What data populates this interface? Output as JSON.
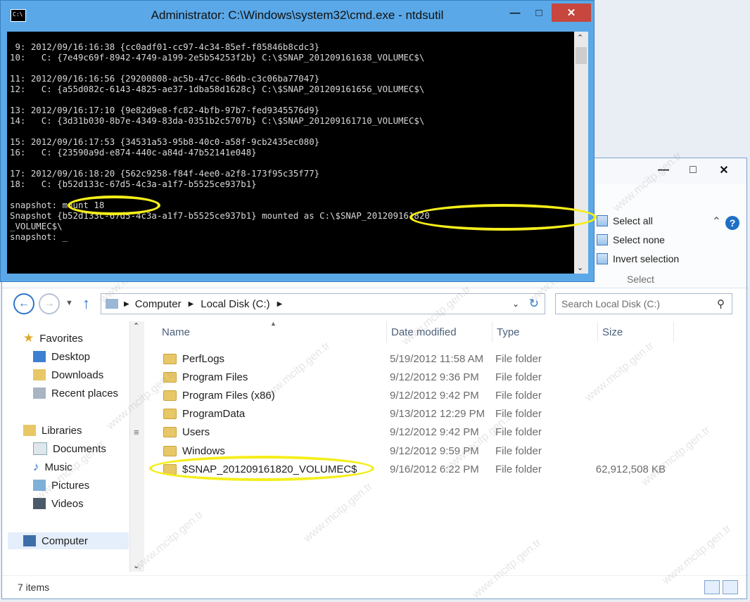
{
  "cmd": {
    "title": "Administrator: C:\\Windows\\system32\\cmd.exe - ntdsutil",
    "icon": "cmd-icon",
    "lines": [
      " 9: 2012/09/16:16:38 {cc0adf01-cc97-4c34-85ef-f85846b8cdc3}",
      "10:   C: {7e49c69f-8942-4749-a199-2e5b54253f2b} C:\\$SNAP_201209161638_VOLUMEC$\\",
      "",
      "11: 2012/09/16:16:56 {29200808-ac5b-47cc-86db-c3c06ba77047}",
      "12:   C: {a55d082c-6143-4825-ae37-1dba58d1628c} C:\\$SNAP_201209161656_VOLUMEC$\\",
      "",
      "13: 2012/09/16:17:10 {9e82d9e8-fc82-4bfb-97b7-fed9345576d9}",
      "14:   C: {3d31b030-8b7e-4349-83da-0351b2c5707b} C:\\$SNAP_201209161710_VOLUMEC$\\",
      "",
      "15: 2012/09/16:17:53 {34531a53-95b8-40c0-a58f-9cb2435ec080}",
      "16:   C: {23590a9d-e874-440c-a84d-47b52141e048}",
      "",
      "17: 2012/09/16:18:20 {562c9258-f84f-4ee0-a2f8-173f95c35f77}",
      "18:   C: {b52d133c-67d5-4c3a-a1f7-b5525ce937b1}",
      "",
      "snapshot: mount 18",
      "Snapshot {b52d133c-67d5-4c3a-a1f7-b5525ce937b1} mounted as C:\\$SNAP_201209161820",
      "_VOLUMEC$\\",
      "snapshot: _"
    ]
  },
  "ribbon": {
    "select_all": "Select all",
    "select_none": "Select none",
    "invert_selection": "Invert selection",
    "group_label": "Select"
  },
  "address": {
    "segments": [
      "Computer",
      "Local Disk (C:)"
    ],
    "search_placeholder": "Search Local Disk (C:)"
  },
  "navpane": {
    "favorites": "Favorites",
    "desktop": "Desktop",
    "downloads": "Downloads",
    "recent_places": "Recent places",
    "libraries": "Libraries",
    "documents": "Documents",
    "music": "Music",
    "pictures": "Pictures",
    "videos": "Videos",
    "computer": "Computer"
  },
  "columns": {
    "name": "Name",
    "date": "Date modified",
    "type": "Type",
    "size": "Size"
  },
  "files": [
    {
      "name": "PerfLogs",
      "date": "5/19/2012 11:58 AM",
      "type": "File folder",
      "size": ""
    },
    {
      "name": "Program Files",
      "date": "9/12/2012 9:36 PM",
      "type": "File folder",
      "size": ""
    },
    {
      "name": "Program Files (x86)",
      "date": "9/12/2012 9:42 PM",
      "type": "File folder",
      "size": ""
    },
    {
      "name": "ProgramData",
      "date": "9/13/2012 12:29 PM",
      "type": "File folder",
      "size": ""
    },
    {
      "name": "Users",
      "date": "9/12/2012 9:42 PM",
      "type": "File folder",
      "size": ""
    },
    {
      "name": "Windows",
      "date": "9/12/2012 9:59 PM",
      "type": "File folder",
      "size": ""
    },
    {
      "name": "$SNAP_201209161820_VOLUMEC$",
      "date": "9/16/2012 6:22 PM",
      "type": "File folder",
      "size": "62,912,508 KB"
    }
  ],
  "status": {
    "item_count": "7 items"
  },
  "watermark": "www.mcitp.gen.tr",
  "colors": {
    "highlight": "#f5ee1a",
    "title_blue": "#5aa8e8",
    "close_red": "#c7463e"
  }
}
